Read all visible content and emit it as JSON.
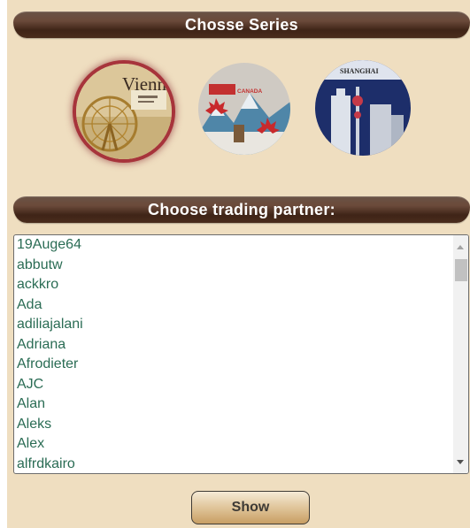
{
  "headers": {
    "series_title": "Chosse Series",
    "partner_title": "Choose trading partner:"
  },
  "series": [
    {
      "name": "vienna",
      "label": "Vienna",
      "selected": true,
      "highlight_color": "#a7343b"
    },
    {
      "name": "canada",
      "label": "CANADA",
      "selected": false
    },
    {
      "name": "shanghai",
      "label": "SHANGHAI",
      "selected": false
    }
  ],
  "partners": {
    "items": [
      "19Auge64",
      "abbutw",
      "ackkro",
      "Ada",
      "adiliajalani",
      "Adriana",
      "Afrodieter",
      "AJC",
      "Alan",
      "Aleks",
      "Alex",
      "alfrdkairo"
    ],
    "text_color": "#2a6c54"
  },
  "show_button": {
    "label": "Show"
  },
  "colors": {
    "panel_bg": "#efdec0",
    "header_dark": "#3f2417"
  }
}
